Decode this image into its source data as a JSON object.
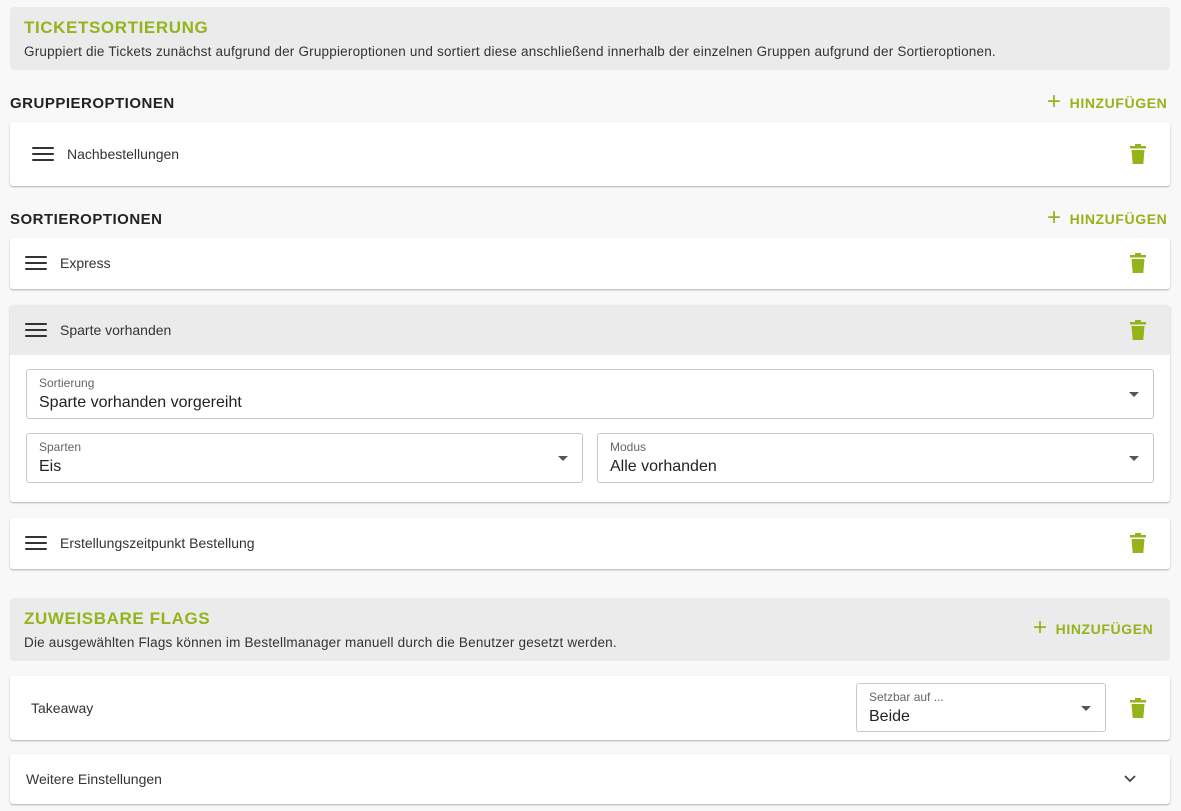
{
  "ticket_sorting": {
    "title": "TICKETSORTIERUNG",
    "description": "Gruppiert die Tickets zunächst aufgrund der Gruppieroptionen und sortiert diese anschließend innerhalb der einzelnen Gruppen aufgrund der Sortieroptionen."
  },
  "group_options": {
    "label": "GRUPPIEROPTIONEN",
    "add_label": "HINZUFÜGEN",
    "items": [
      {
        "label": "Nachbestellungen"
      }
    ]
  },
  "sort_options": {
    "label": "SORTIEROPTIONEN",
    "add_label": "HINZUFÜGEN",
    "items": [
      {
        "label": "Express"
      },
      {
        "label": "Sparte vorhanden",
        "sort_field": {
          "label": "Sortierung",
          "value": "Sparte vorhanden vorgereiht"
        },
        "divisions_field": {
          "label": "Sparten",
          "value": "Eis"
        },
        "mode_field": {
          "label": "Modus",
          "value": "Alle vorhanden"
        }
      },
      {
        "label": "Erstellungszeitpunkt Bestellung"
      }
    ]
  },
  "flags": {
    "title": "ZUWEISBARE FLAGS",
    "description": "Die ausgewählten Flags können im Bestellmanager manuell durch die Benutzer gesetzt werden.",
    "add_label": "HINZUFÜGEN",
    "items": [
      {
        "label": "Takeaway",
        "settable_field": {
          "label": "Setzbar auf ...",
          "value": "Beide"
        }
      }
    ]
  },
  "more_settings": {
    "label": "Weitere Einstellungen"
  },
  "colors": {
    "accent": "#95b31b",
    "header_bg": "#ebebeb",
    "page_bg": "#f8f8f8"
  },
  "icons": {
    "drag": "drag-handle-icon",
    "delete": "trash-icon",
    "add": "plus-icon",
    "dropdown": "caret-down-icon",
    "expand": "chevron-down-icon"
  }
}
